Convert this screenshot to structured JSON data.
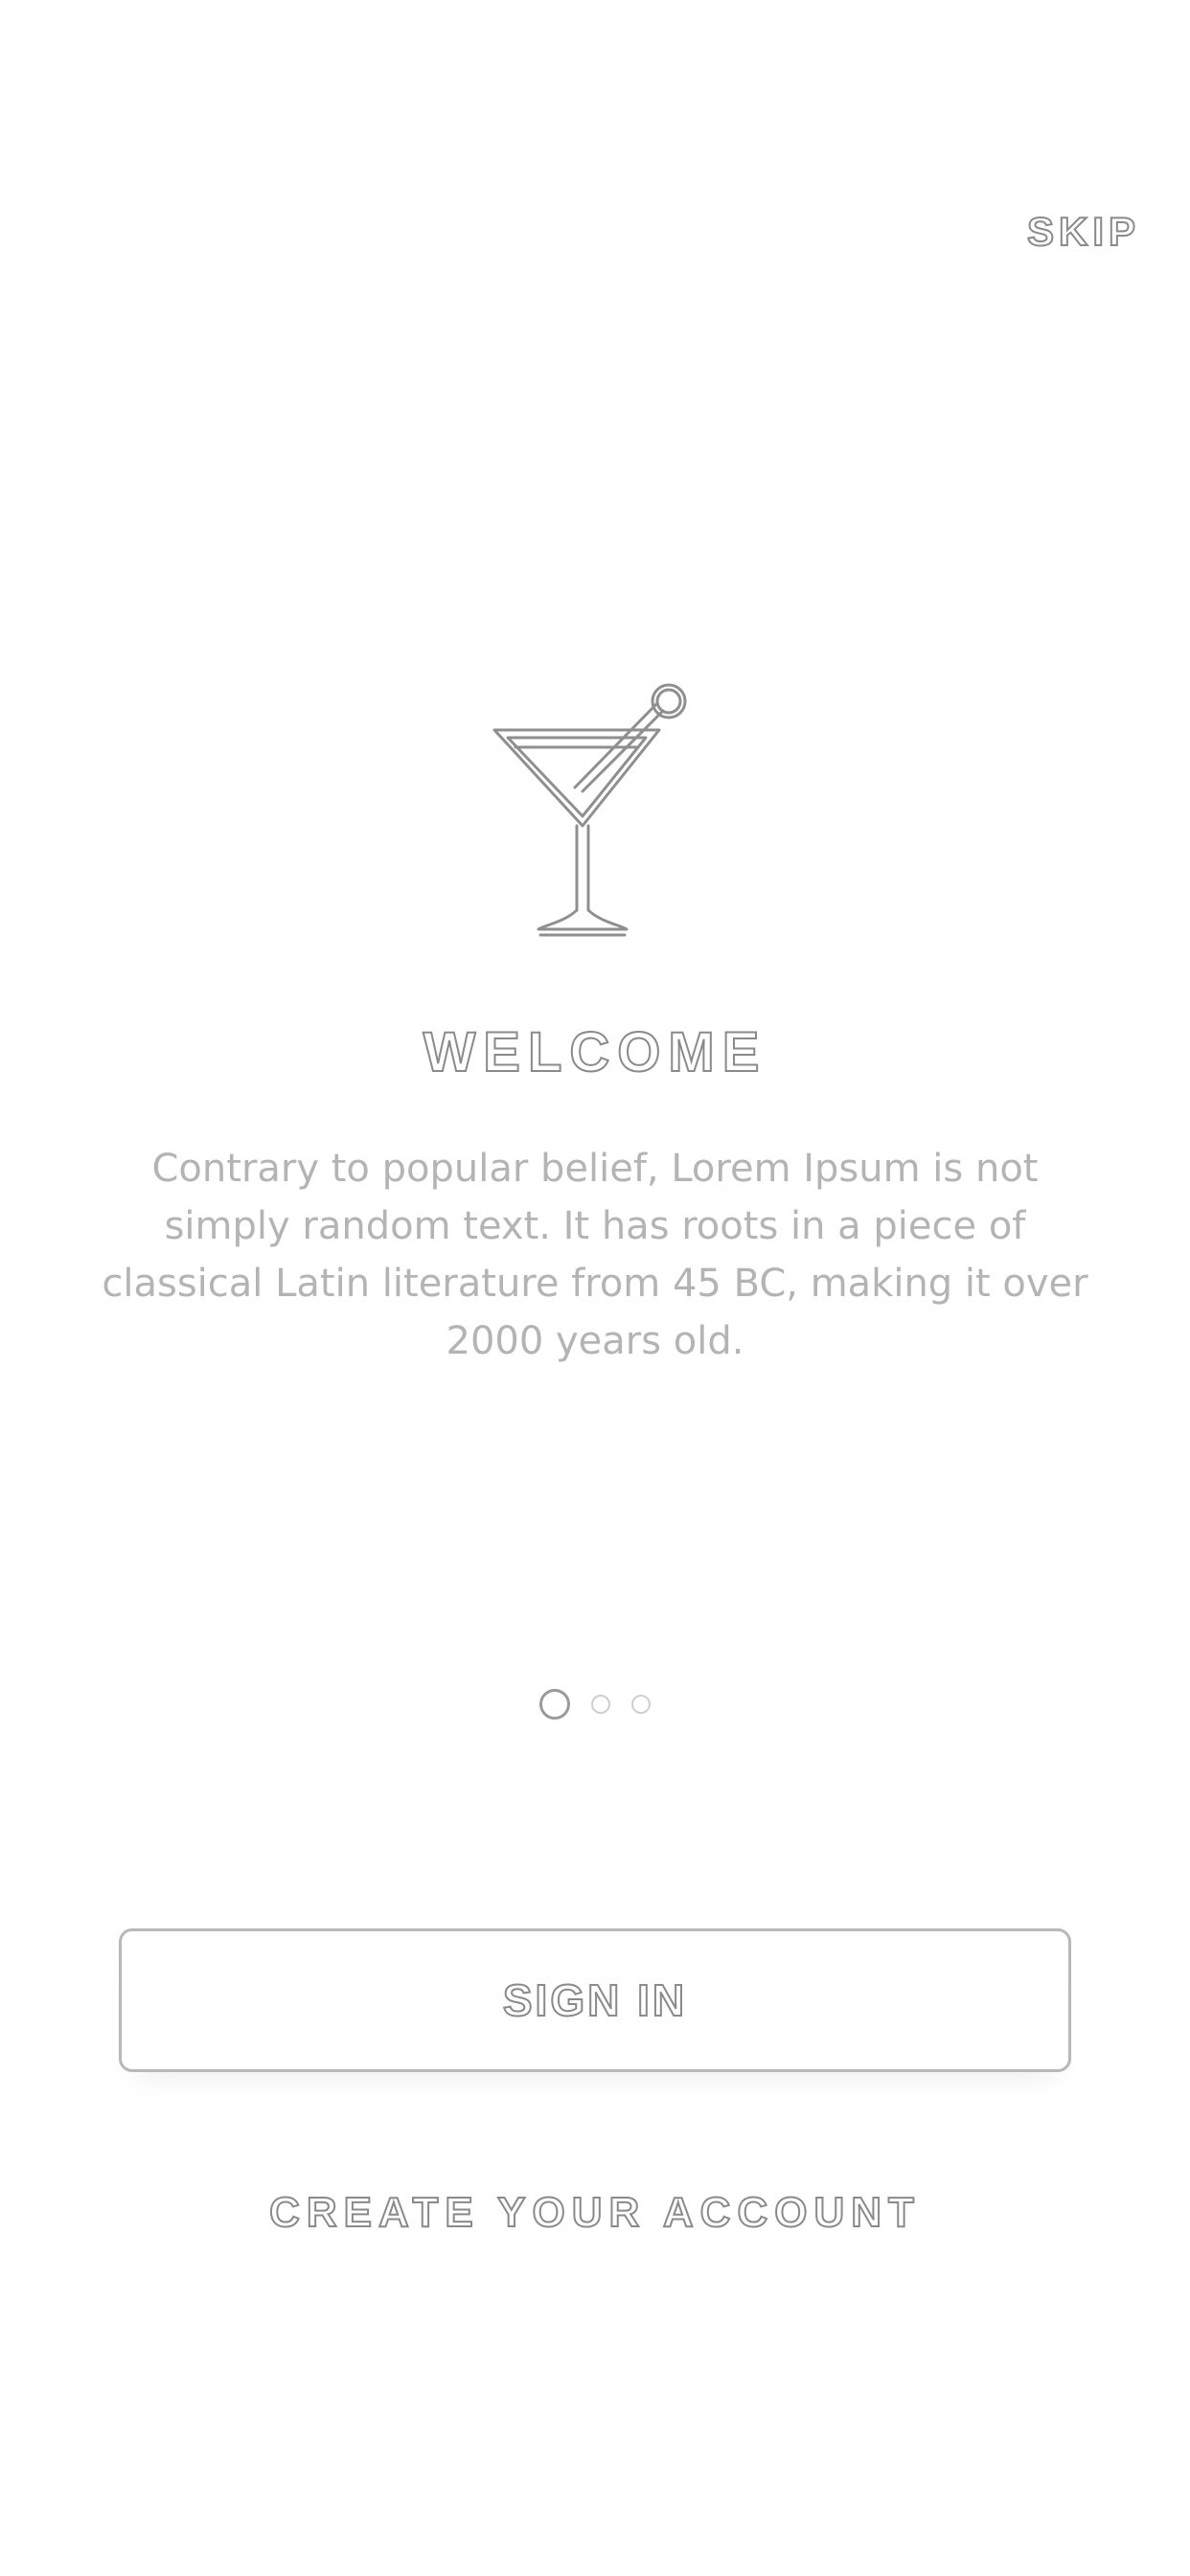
{
  "header": {
    "skip_label": "SKIP"
  },
  "hero": {
    "icon": "cocktail-glass-icon",
    "title": "WELCOME",
    "description": "Contrary to popular belief, Lorem Ipsum is not simply random text. It has roots in a piece of classical Latin literature from 45 BC, making it over 2000 years old."
  },
  "pagination": {
    "total_pages": 3,
    "active_page": 1
  },
  "actions": {
    "sign_in_label": "SIGN IN",
    "create_account_label": "CREATE YOUR ACCOUNT"
  },
  "colors": {
    "background": "#ffffff",
    "outline_text": "#8a8a8a",
    "body_text": "#b4b4b4",
    "button_border": "#b8b8b8"
  }
}
